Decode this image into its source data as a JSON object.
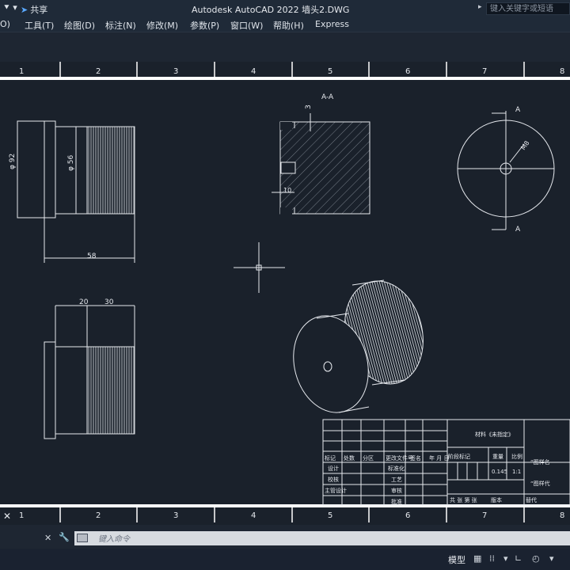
{
  "app": {
    "title": "Autodesk AutoCAD 2022   墙头2.DWG",
    "share_label": "共享",
    "search_placeholder": "键入关键字或短语"
  },
  "menu": [
    "O)",
    "工具(T)",
    "绘图(D)",
    "标注(N)",
    "修改(M)",
    "参数(P)",
    "窗口(W)",
    "帮助(H)",
    "Express"
  ],
  "ruler": [
    "1",
    "2",
    "3",
    "4",
    "5",
    "6",
    "7",
    "8"
  ],
  "drawing": {
    "dims": {
      "d92": "φ 92",
      "d56": "φ 56",
      "len58": "58",
      "len20": "20",
      "len30": "30",
      "sec3": "3",
      "sec10": "10",
      "m8": "M8"
    },
    "section_label": "A-A",
    "marker_a": "A"
  },
  "title_block": {
    "material": "材料《未指定》",
    "head": [
      "标记",
      "处数",
      "分区",
      "更改文件号",
      "签名",
      "年 月 日"
    ],
    "rows": [
      "设计",
      "校核",
      "主管设计"
    ],
    "std": "标准化",
    "process": "工艺",
    "audit": "审核",
    "approve": "批准",
    "stage": "阶段标记",
    "weight": "重量",
    "scale": "比例",
    "weight_val": "0.145",
    "scale_val": "1:1",
    "sheet": "共 张 第 张",
    "version": "版本",
    "replace": "替代",
    "drawing_name1": "“图样名",
    "drawing_name2": "“图样代"
  },
  "command": {
    "placeholder": "键入命令"
  },
  "status": {
    "model_label": "模型"
  },
  "icons": [
    "menu-icon",
    "share-icon",
    "search-icon",
    "close-icon",
    "wrench-icon",
    "grid-icon",
    "snap-icon",
    "ortho-icon",
    "polar-icon"
  ]
}
